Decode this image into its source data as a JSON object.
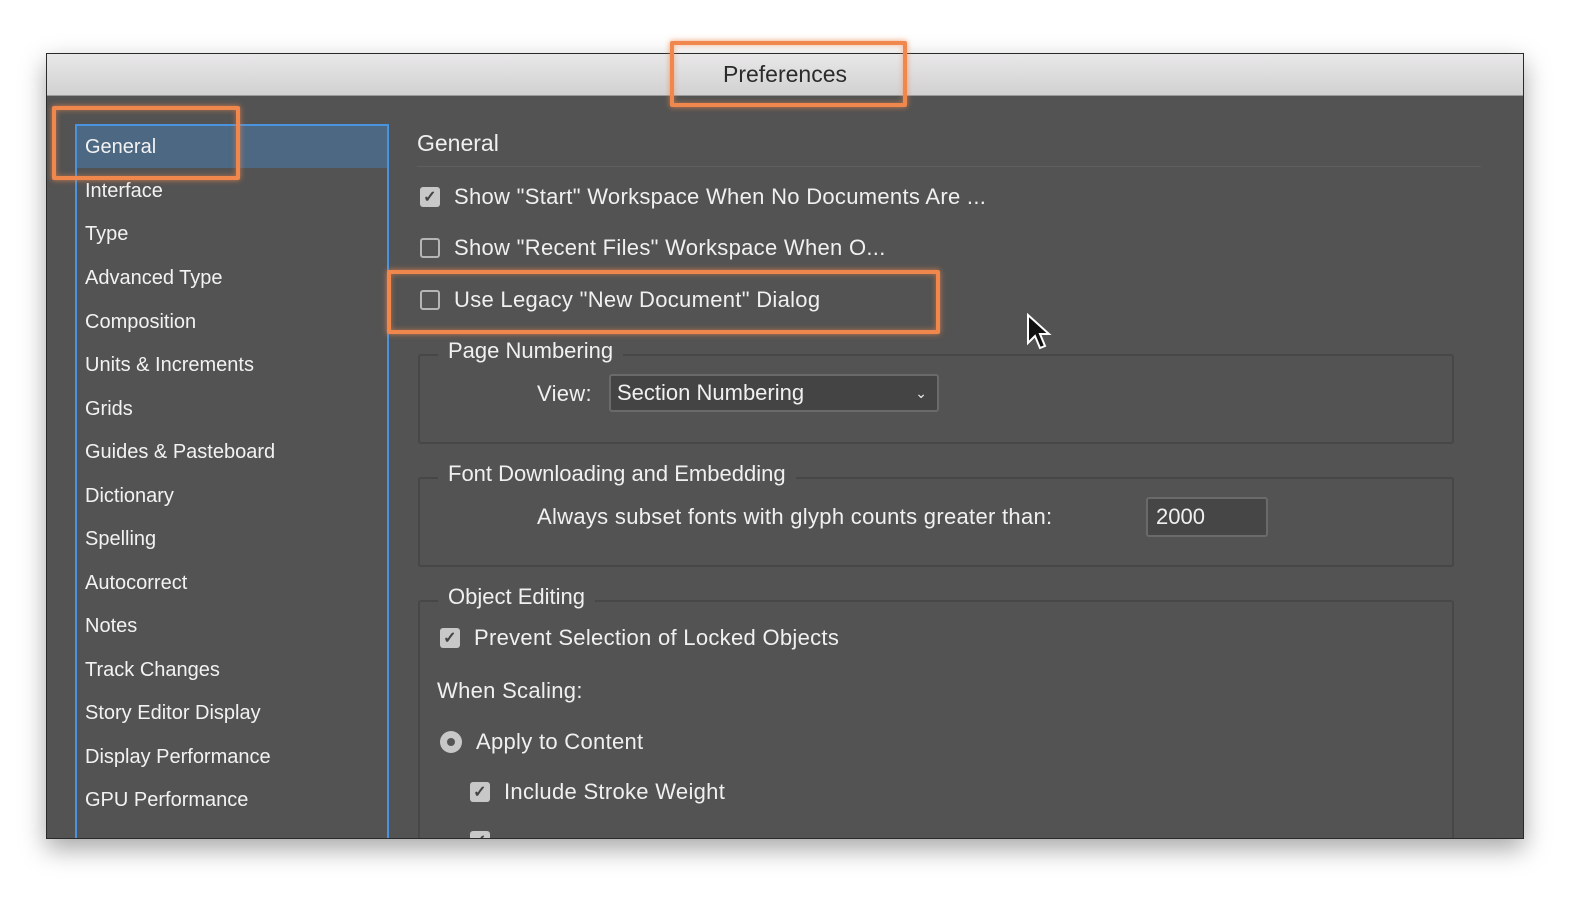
{
  "window": {
    "title": "Preferences"
  },
  "sidebar": {
    "items": [
      {
        "label": "General",
        "selected": true
      },
      {
        "label": "Interface"
      },
      {
        "label": "Type"
      },
      {
        "label": "Advanced Type"
      },
      {
        "label": "Composition"
      },
      {
        "label": "Units & Increments"
      },
      {
        "label": "Grids"
      },
      {
        "label": "Guides & Pasteboard"
      },
      {
        "label": "Dictionary"
      },
      {
        "label": "Spelling"
      },
      {
        "label": "Autocorrect"
      },
      {
        "label": "Notes"
      },
      {
        "label": "Track Changes"
      },
      {
        "label": "Story Editor Display"
      },
      {
        "label": "Display Performance"
      },
      {
        "label": "GPU Performance"
      }
    ]
  },
  "main": {
    "heading": "General",
    "options": [
      {
        "label": "Show \"Start\" Workspace When No Documents Are ...",
        "checked": true
      },
      {
        "label": "Show \"Recent Files\" Workspace When O...",
        "checked": false
      },
      {
        "label": "Use Legacy \"New Document\" Dialog",
        "checked": false
      }
    ],
    "page_numbering": {
      "title": "Page Numbering",
      "view_label": "View:",
      "view_value": "Section Numbering"
    },
    "font_downloading": {
      "title": "Font Downloading and Embedding",
      "subset_label": "Always subset fonts with glyph counts greater than:",
      "subset_value": "2000"
    },
    "object_editing": {
      "title": "Object Editing",
      "prevent_locked": {
        "label": "Prevent Selection of Locked Objects",
        "checked": true
      },
      "when_scaling": "When Scaling:",
      "apply_to_content": {
        "label": "Apply to Content",
        "selected": true
      },
      "include_stroke": {
        "label": "Include Stroke Weight",
        "checked": true
      }
    }
  },
  "colors": {
    "highlight": "#f0874d",
    "selection": "#4d6882",
    "list_border": "#4a93de",
    "panel": "#535353"
  }
}
